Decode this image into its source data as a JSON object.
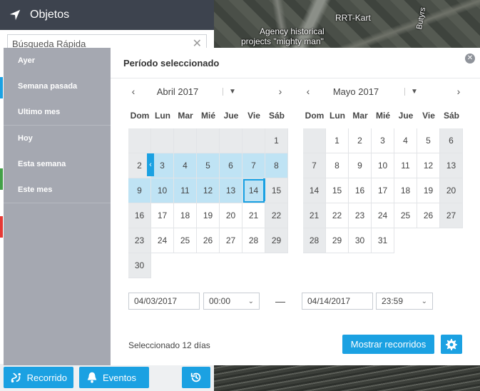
{
  "map": {
    "labels": [
      "RRT-Kart",
      "Agency historical",
      "projects \"mighty man\"",
      "Butyrs"
    ]
  },
  "objects_panel": {
    "title": "Objetos",
    "search_placeholder": "Búsqueda Rápida",
    "color_bars": [
      "#1ba1e2",
      "#43a047",
      "#e53935"
    ]
  },
  "bottom_toolbar": {
    "route_label": "Recorrido",
    "events_label": "Eventos"
  },
  "range_options": [
    "Ayer",
    "Semana pasada",
    "Ultimo mes",
    "Hoy",
    "Esta semana",
    "Este mes"
  ],
  "picker": {
    "title": "Período seleccionado",
    "weekdays": [
      "Dom",
      "Lun",
      "Mar",
      "Mié",
      "Jue",
      "Vie",
      "Sáb"
    ],
    "left_month": {
      "name": "Abril 2017",
      "weeks": [
        [
          "",
          "",
          "",
          "",
          "",
          "",
          "1"
        ],
        [
          "2",
          "3",
          "4",
          "5",
          "6",
          "7",
          "8"
        ],
        [
          "9",
          "10",
          "11",
          "12",
          "13",
          "14",
          "15"
        ],
        [
          "16",
          "17",
          "18",
          "19",
          "20",
          "21",
          "22"
        ],
        [
          "23",
          "24",
          "25",
          "26",
          "27",
          "28",
          "29"
        ],
        [
          "30",
          "",
          "",
          "",
          "",
          "",
          ""
        ]
      ],
      "selected_days": [
        "3",
        "4",
        "5",
        "6",
        "7",
        "8",
        "9",
        "10",
        "11",
        "12",
        "13",
        "14"
      ],
      "range_end": "14"
    },
    "right_month": {
      "name": "Mayo 2017",
      "weeks": [
        [
          "",
          "1",
          "2",
          "3",
          "4",
          "5",
          "6"
        ],
        [
          "7",
          "8",
          "9",
          "10",
          "11",
          "12",
          "13"
        ],
        [
          "14",
          "15",
          "16",
          "17",
          "18",
          "19",
          "20"
        ],
        [
          "21",
          "22",
          "23",
          "24",
          "25",
          "26",
          "27"
        ],
        [
          "28",
          "29",
          "30",
          "31",
          "",
          "",
          ""
        ]
      ]
    },
    "from_date": "04/03/2017",
    "from_time": "00:00",
    "separator": "—",
    "to_date": "04/14/2017",
    "to_time": "23:59",
    "summary": "Seleccionado 12 días",
    "show_button": "Mostrar recorridos",
    "accent_color": "#1ba1e2"
  }
}
